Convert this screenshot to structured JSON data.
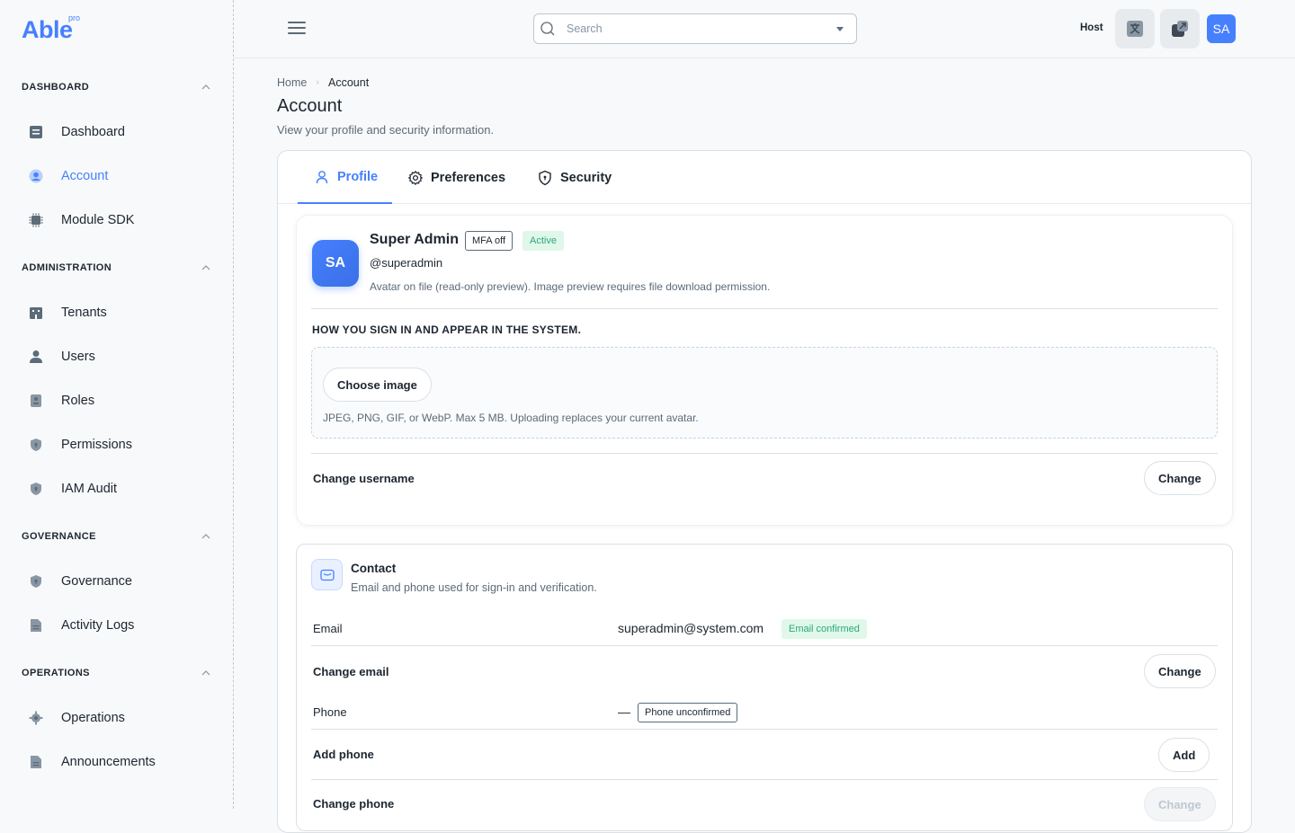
{
  "brand": {
    "name": "Able",
    "tag": "pro"
  },
  "sidebar": {
    "sections": [
      {
        "header": "DASHBOARD",
        "items": [
          {
            "label": "Dashboard",
            "icon": "dashboard-icon"
          },
          {
            "label": "Account",
            "icon": "account-icon",
            "active": true
          },
          {
            "label": "Module SDK",
            "icon": "chip-icon"
          }
        ]
      },
      {
        "header": "ADMINISTRATION",
        "items": [
          {
            "label": "Tenants",
            "icon": "building-icon"
          },
          {
            "label": "Users",
            "icon": "user-icon"
          },
          {
            "label": "Roles",
            "icon": "id-badge-icon"
          },
          {
            "label": "Permissions",
            "icon": "shield-icon"
          },
          {
            "label": "IAM Audit",
            "icon": "shield-icon"
          }
        ]
      },
      {
        "header": "GOVERNANCE",
        "items": [
          {
            "label": "Governance",
            "icon": "shield-icon"
          },
          {
            "label": "Activity Logs",
            "icon": "document-icon"
          }
        ]
      },
      {
        "header": "OPERATIONS",
        "items": [
          {
            "label": "Operations",
            "icon": "gear-icon"
          },
          {
            "label": "Announcements",
            "icon": "document-icon"
          }
        ]
      }
    ]
  },
  "topbar": {
    "search_placeholder": "Search",
    "host_label": "Host",
    "avatar_initials": "SA"
  },
  "breadcrumb": {
    "home": "Home",
    "current": "Account"
  },
  "page": {
    "title": "Account",
    "subtitle": "View your profile and security information."
  },
  "tabs": [
    {
      "label": "Profile",
      "active": true
    },
    {
      "label": "Preferences"
    },
    {
      "label": "Security"
    }
  ],
  "profile": {
    "initials": "SA",
    "display_name": "Super Admin",
    "mfa_badge": "MFA off",
    "status_badge": "Active",
    "handle": "@superadmin",
    "avatar_note": "Avatar on file (read-only preview). Image preview requires file download permission.",
    "section_caption": "HOW YOU SIGN IN AND APPEAR IN THE SYSTEM.",
    "choose_image_label": "Choose image",
    "upload_note": "JPEG, PNG, GIF, or WebP. Max 5 MB. Uploading replaces your current avatar.",
    "change_username_label": "Change username",
    "change_button": "Change"
  },
  "contact": {
    "title": "Contact",
    "subtitle": "Email and phone used for sign-in and verification.",
    "email_label": "Email",
    "email_value": "superadmin@system.com",
    "email_badge": "Email confirmed",
    "change_email_label": "Change email",
    "change_button": "Change",
    "phone_label": "Phone",
    "phone_value": "—",
    "phone_badge": "Phone unconfirmed",
    "add_phone_label": "Add phone",
    "add_button": "Add",
    "change_phone_label": "Change phone",
    "change_phone_button": "Change"
  },
  "colors": {
    "primary": "#4680ff",
    "success": "#2ca87f",
    "text": "#1d2630",
    "muted": "#5b6b79"
  }
}
